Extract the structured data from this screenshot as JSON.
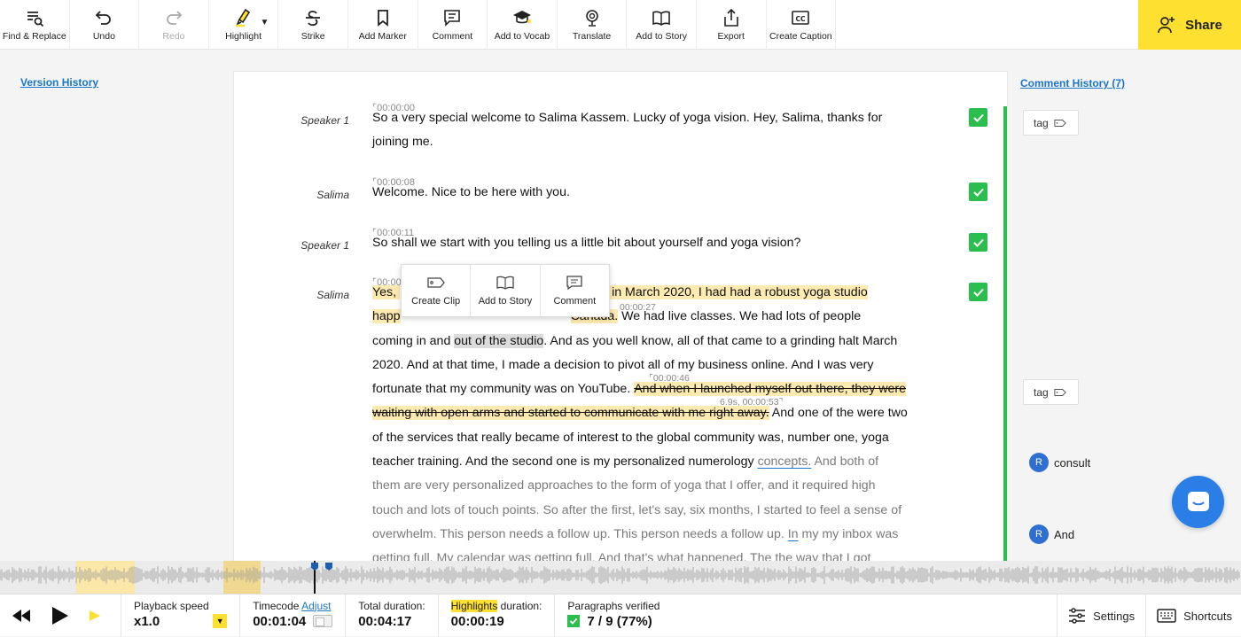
{
  "toolbar": {
    "find_replace": "Find & Replace",
    "undo": "Undo",
    "redo": "Redo",
    "highlight": "Highlight",
    "strike": "Strike",
    "add_marker": "Add Marker",
    "comment": "Comment",
    "add_to_vocab": "Add to Vocab",
    "translate": "Translate",
    "add_to_story": "Add to Story",
    "export": "Export",
    "create_caption": "Create Caption",
    "share": "Share"
  },
  "links": {
    "version_history": "Version History",
    "comment_history": "Comment History (7)"
  },
  "paragraphs": [
    {
      "speaker": "Speaker 1",
      "time": "⌜00:00:00",
      "text1": "So a very special welcome to Salima Kassem. Lucky of yoga vision. Hey, Salima, thanks for",
      "text2": "joining me."
    },
    {
      "speaker": "Salima",
      "time": "⌜00:00:08",
      "text1": "Welcome. Nice to be here with you."
    },
    {
      "speaker": "Speaker 1",
      "time": "⌜00:00:11",
      "text1": "So shall we start with you telling us a little bit about yourself and yoga vision?"
    },
    {
      "speaker": "Salima",
      "time": "⌜00:00"
    }
  ],
  "p4": {
    "l1a": "Yes, ",
    "l1b": "s in March 2020, I had had a robust yoga studio",
    "l2a": "happ",
    "l2mt": "00:00:27",
    "l2b": "Canada.",
    "l2c": " We had live classes. We had lots of people",
    "l3a": "coming in and ",
    "l3sel": "out of the studio",
    "l3b": ". And as you well know, all of that came to a grinding halt March",
    "l4": "2020. And at that time, I made a decision to pivot all of my business online. And I was very",
    "l5a": "fortunate that my community was on YouTube. ",
    "l5mt": "⌜00:00:46",
    "l5b": "And when I launched myself out there, they were",
    "l6mt": "6.9s, 00:00:53⌝",
    "l6a": "waiting with open arms and started to communicate with me right away.",
    "l6b": " And one of the were two",
    "l7": "of the services that really became of interest to the global community was, number one, yoga",
    "l8a": "teacher training. And the second one is my personalized numerology ",
    "l8u": "concepts.",
    "l8b": " And both of",
    "l9": "them are very personalized approaches to the form of yoga that I offer, and it required high",
    "l10": "touch and lots of touch points. So after the first, let's say, six months, I started to feel a sense of",
    "l11a": "overwhelm. This person needs a follow up. This person needs a follow up. ",
    "l11u": "In",
    "l11b": " my my inbox was",
    "l12": "getting full. My calendar was getting full. And that's what happened. The the way that I got"
  },
  "popup": {
    "create_clip": "Create Clip",
    "add_to_story": "Add to Story",
    "comment": "Comment"
  },
  "sidebar": {
    "tag1": "tag",
    "tag2": "tag",
    "comments": [
      {
        "avatar": "R",
        "text": "consult"
      },
      {
        "avatar": "R",
        "text": "And"
      }
    ]
  },
  "bottom": {
    "playback_label": "Playback speed",
    "playback_value": "x1.0",
    "timecode_label": "Timecode",
    "adjust": "Adjust",
    "timecode_value": "00:01:04",
    "total_label": "Total duration:",
    "total_value": "00:04:17",
    "hl_label_a": "Highlights",
    "hl_label_b": " duration:",
    "hl_value": "00:00:19",
    "verified_label": "Paragraphs verified",
    "verified_value": "7 / 9 (77%)",
    "settings": "Settings",
    "shortcuts": "Shortcuts"
  },
  "colors": {
    "accent_yellow": "#fde030",
    "link_blue": "#1b75c9",
    "verified_green": "#2cbd4f",
    "highlight": "#fdeab0"
  }
}
